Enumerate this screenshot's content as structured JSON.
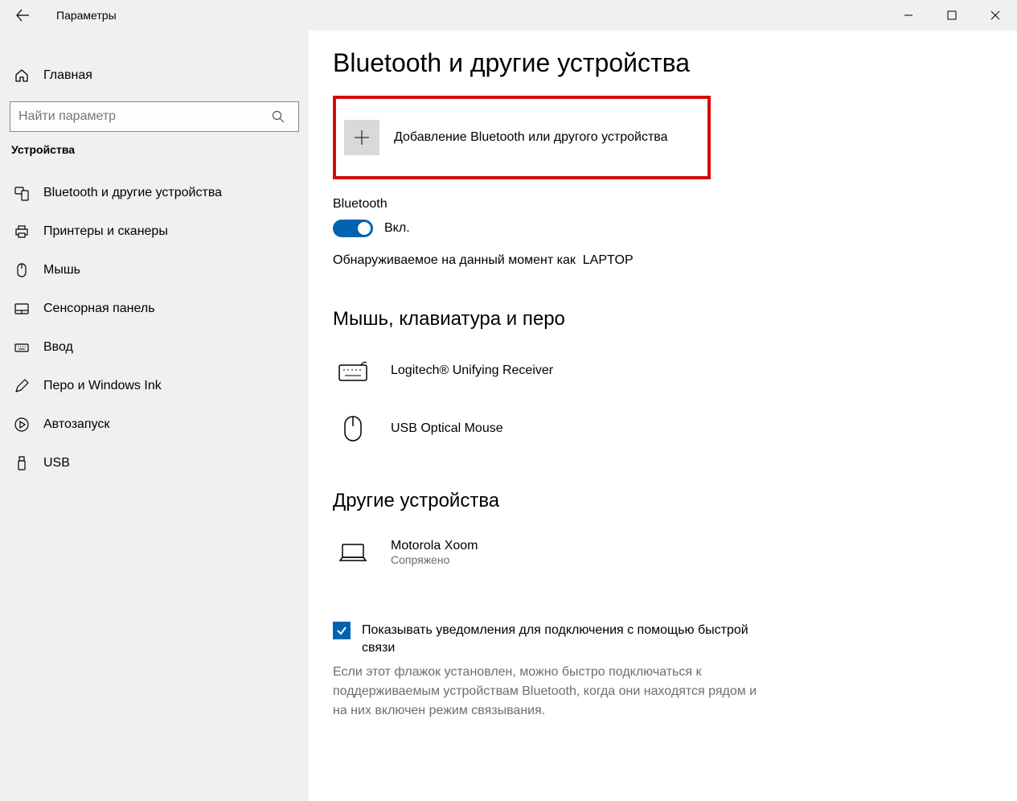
{
  "titlebar": {
    "title": "Параметры"
  },
  "sidebar": {
    "home": "Главная",
    "search_placeholder": "Найти параметр",
    "category": "Устройства",
    "items": [
      {
        "label": "Bluetooth и другие устройства"
      },
      {
        "label": "Принтеры и сканеры"
      },
      {
        "label": "Мышь"
      },
      {
        "label": "Сенсорная панель"
      },
      {
        "label": "Ввод"
      },
      {
        "label": "Перо и Windows Ink"
      },
      {
        "label": "Автозапуск"
      },
      {
        "label": "USB"
      }
    ]
  },
  "main": {
    "heading": "Bluetooth и другие устройства",
    "add_device": "Добавление Bluetooth или другого устройства",
    "bluetooth_label": "Bluetooth",
    "toggle_state": "Вкл.",
    "discoverable_prefix": "Обнаруживаемое на данный момент как",
    "discoverable_name": "LAPTOP",
    "group_input": "Мышь, клавиатура и перо",
    "devices_input": [
      {
        "name": "Logitech® Unifying Receiver"
      },
      {
        "name": "USB Optical Mouse"
      }
    ],
    "group_other": "Другие устройства",
    "devices_other": [
      {
        "name": "Motorola Xoom",
        "status": "Сопряжено"
      }
    ],
    "quick_connect_label": "Показывать уведомления для подключения с помощью быстрой связи",
    "quick_connect_desc": "Если этот флажок установлен, можно быстро подключаться к поддерживаемым устройствам Bluetooth, когда они находятся рядом и на них включен режим связывания."
  }
}
